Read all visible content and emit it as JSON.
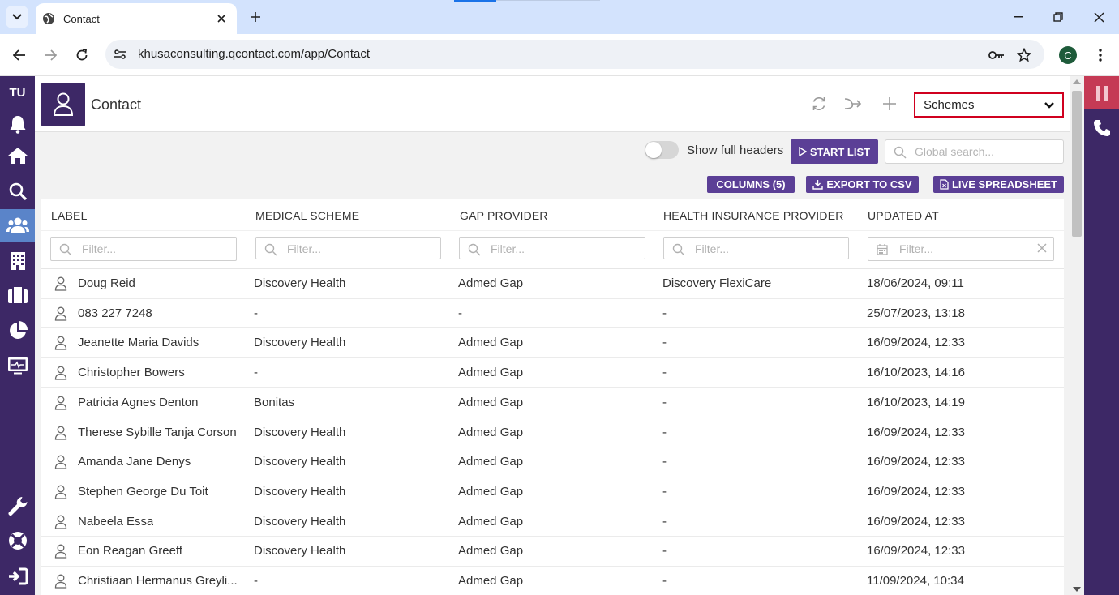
{
  "browser": {
    "tab_title": "Contact",
    "url": "khusaconsulting.qcontact.com/app/Contact",
    "profile_initial": "C"
  },
  "sidebar": {
    "brand": "TU",
    "items": [
      {
        "name": "bell-icon"
      },
      {
        "name": "home-icon"
      },
      {
        "name": "search-icon"
      },
      {
        "name": "contacts-icon",
        "active": true
      },
      {
        "name": "building-icon"
      },
      {
        "name": "briefcase-icon"
      },
      {
        "name": "pie-chart-icon"
      },
      {
        "name": "monitor-icon"
      },
      {
        "name": "wrench-icon"
      },
      {
        "name": "lifebuoy-icon"
      },
      {
        "name": "logout-icon"
      }
    ]
  },
  "header": {
    "title": "Contact",
    "scheme_select": "Schemes"
  },
  "toolbar": {
    "toggle_label": "Show full headers",
    "start_list": "START LIST",
    "global_search_placeholder": "Global search...",
    "columns": "COLUMNS (5)",
    "export_csv": "EXPORT TO CSV",
    "live_spreadsheet": "LIVE SPREADSHEET"
  },
  "table": {
    "columns": [
      "LABEL",
      "MEDICAL SCHEME",
      "GAP PROVIDER",
      "HEALTH INSURANCE PROVIDER",
      "UPDATED AT"
    ],
    "filter_placeholder": "Filter...",
    "rows": [
      [
        "Doug Reid",
        "Discovery Health",
        "Admed Gap",
        "Discovery FlexiCare",
        "18/06/2024, 09:11"
      ],
      [
        "083 227 7248",
        "-",
        "-",
        "-",
        "25/07/2023, 13:18"
      ],
      [
        "Jeanette Maria Davids",
        "Discovery Health",
        "Admed Gap",
        "-",
        "16/09/2024, 12:33"
      ],
      [
        "Christopher Bowers",
        "-",
        "Admed Gap",
        "-",
        "16/10/2023, 14:16"
      ],
      [
        "Patricia Agnes Denton",
        "Bonitas",
        "Admed Gap",
        "-",
        "16/10/2023, 14:19"
      ],
      [
        "Therese Sybille Tanja Corson",
        "Discovery Health",
        "Admed Gap",
        "-",
        "16/09/2024, 12:33"
      ],
      [
        "Amanda Jane Denys",
        "Discovery Health",
        "Admed Gap",
        "-",
        "16/09/2024, 12:33"
      ],
      [
        "Stephen George Du Toit",
        "Discovery Health",
        "Admed Gap",
        "-",
        "16/09/2024, 12:33"
      ],
      [
        "Nabeela Essa",
        "Discovery Health",
        "Admed Gap",
        "-",
        "16/09/2024, 12:33"
      ],
      [
        "Eon Reagan Greeff",
        "Discovery Health",
        "Admed Gap",
        "-",
        "16/09/2024, 12:33"
      ],
      [
        "Christiaan Hermanus Greyli...",
        "-",
        "Admed Gap",
        "-",
        "11/09/2024, 10:34"
      ]
    ]
  },
  "colors": {
    "brand_purple": "#3d2866",
    "button_purple": "#5b3f96",
    "highlight_red": "#d0001f"
  }
}
